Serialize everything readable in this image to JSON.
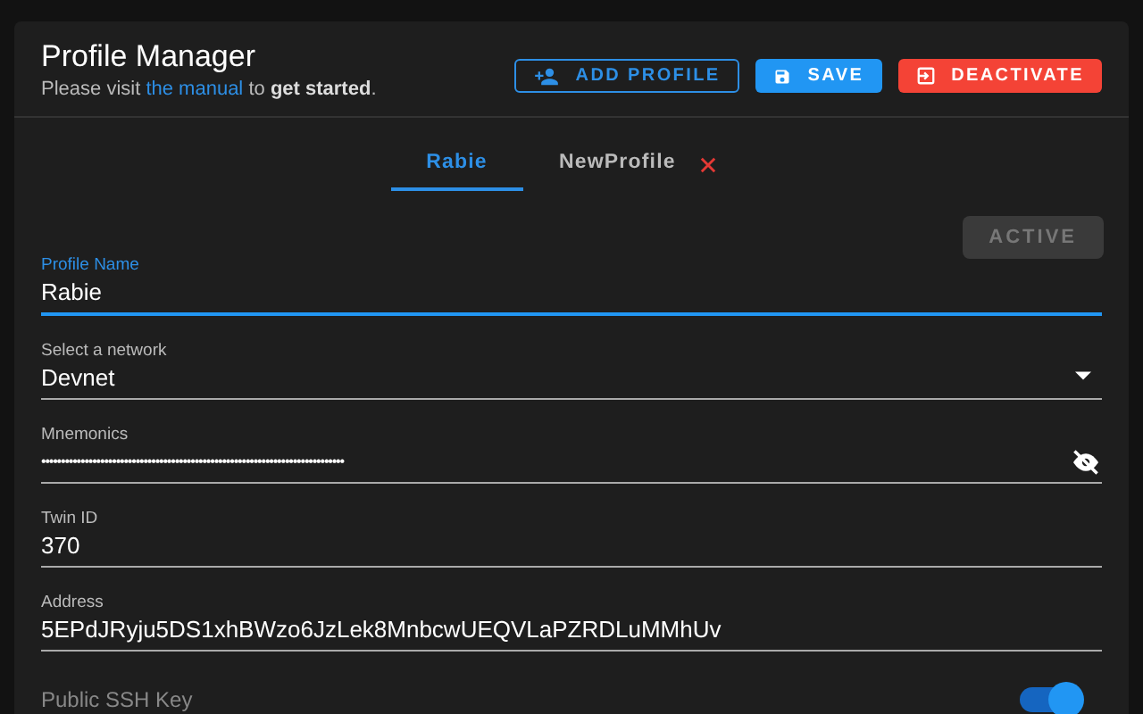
{
  "header": {
    "title": "Profile Manager",
    "subtitle_before": "Please visit ",
    "link": "the manual",
    "subtitle_after": " to **get started**."
  },
  "buttons": [
    {
      "kind": "outline",
      "label": "ADD PROFILE"
    },
    {
      "kind": "save",
      "label": "SAVE"
    },
    {
      "kind": "danger",
      "label": "DEACTIVATE"
    }
  ],
  "tabs": [
    {
      "label": "Rabie",
      "selected": true,
      "closable": false
    },
    {
      "label": "NewProfile",
      "selected": false,
      "closable": true
    }
  ],
  "status_button": {
    "label": "ACTIVE",
    "disabled": true
  },
  "fields": [
    {
      "kind": "text",
      "label": "Profile Name",
      "value": "Rabie",
      "focused": true
    },
    {
      "kind": "select",
      "label": "Select a network",
      "value": "Devnet",
      "focused": false
    },
    {
      "kind": "password",
      "label": "Mnemonics",
      "value": "•••••••••••••••••••••••••••••••••••••••••••••••••••••••••••••••••••••••••••••",
      "focused": false
    },
    {
      "kind": "text",
      "label": "Twin ID",
      "value": "370",
      "focused": false
    },
    {
      "kind": "text",
      "label": "Address",
      "value": "5EPdJRyju5DS1xhBWzo6JzLek8MnbcwUEQVLaPZRDLuMMhUv",
      "focused": false
    }
  ],
  "ssh": {
    "label": "Public SSH Key",
    "on": true
  }
}
